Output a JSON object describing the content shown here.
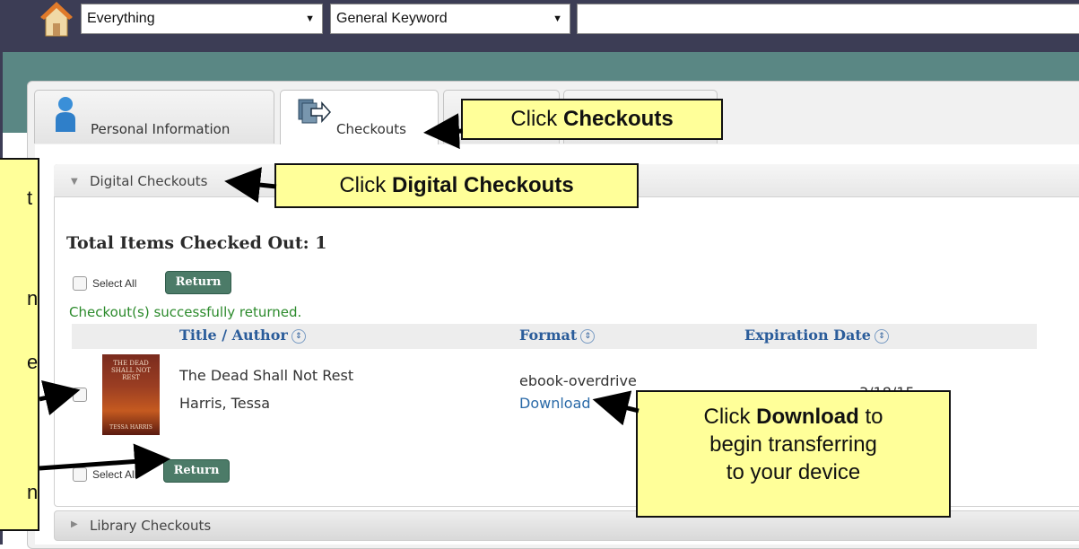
{
  "search": {
    "scope_value": "Everything",
    "type_value": "General Keyword",
    "query_value": ""
  },
  "tabs": [
    {
      "label": "Personal Information"
    },
    {
      "label": "Checkouts"
    }
  ],
  "digital": {
    "header": "Digital Checkouts",
    "total": "Total Items Checked Out: 1",
    "select_all": "Select All",
    "return_label": "Return",
    "success_msg": "Checkout(s) successfully returned.",
    "columns": {
      "title": "Title / Author",
      "format": "Format",
      "expiration": "Expiration Date"
    },
    "item": {
      "cover_title": "THE DEAD SHALL NOT REST",
      "cover_author": "TESSA HARRIS",
      "title": "The Dead Shall Not Rest",
      "author": "Harris, Tessa",
      "format": "ebook-overdrive",
      "download": "Download",
      "expiration_partial": "3/18/15"
    }
  },
  "library": {
    "header": "Library Checkouts"
  },
  "callouts": {
    "checkouts_pre": "Click ",
    "checkouts_bold": "Checkouts",
    "digital_pre": "Click ",
    "digital_bold": "Digital Checkouts",
    "download_pre": "Click ",
    "download_bold": "Download",
    "download_post1": " to",
    "download_line2": "begin transferring",
    "download_line3": "to your device",
    "left_frag1": "t",
    "left_frag2": "n",
    "left_frag3": "e",
    "left_frag4": "n"
  },
  "colors": {
    "topbar": "#3c3d55",
    "band": "#5a8784",
    "callout": "#ffff99",
    "link": "#2a6aa8",
    "return_btn": "#4c7b68",
    "success": "#2b8a2b"
  }
}
